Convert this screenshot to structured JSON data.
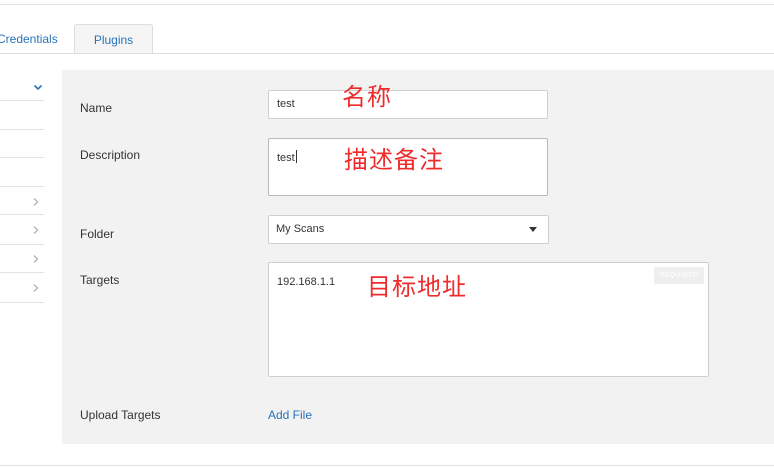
{
  "tabs": [
    {
      "label": "Credentials"
    },
    {
      "label": "Plugins"
    }
  ],
  "form": {
    "name": {
      "label": "Name",
      "value": "test",
      "annotation": "名称"
    },
    "description": {
      "label": "Description",
      "value": "test",
      "annotation": "描述备注"
    },
    "folder": {
      "label": "Folder",
      "selected": "My Scans"
    },
    "targets": {
      "label": "Targets",
      "value": "192.168.1.1",
      "annotation": "目标地址",
      "badge": "REQUIRED"
    },
    "upload_targets": {
      "label": "Upload Targets",
      "link": "Add File"
    }
  },
  "icons": {
    "sidebar_expanded": "chevron-down-icon",
    "sidebar_collapsed": "chevron-right-icon",
    "select_dropdown": "caret-down-icon"
  },
  "colors": {
    "link": "#2a73b8",
    "annotation": "#ee2c2c",
    "panel_background": "#f2f2f2"
  }
}
